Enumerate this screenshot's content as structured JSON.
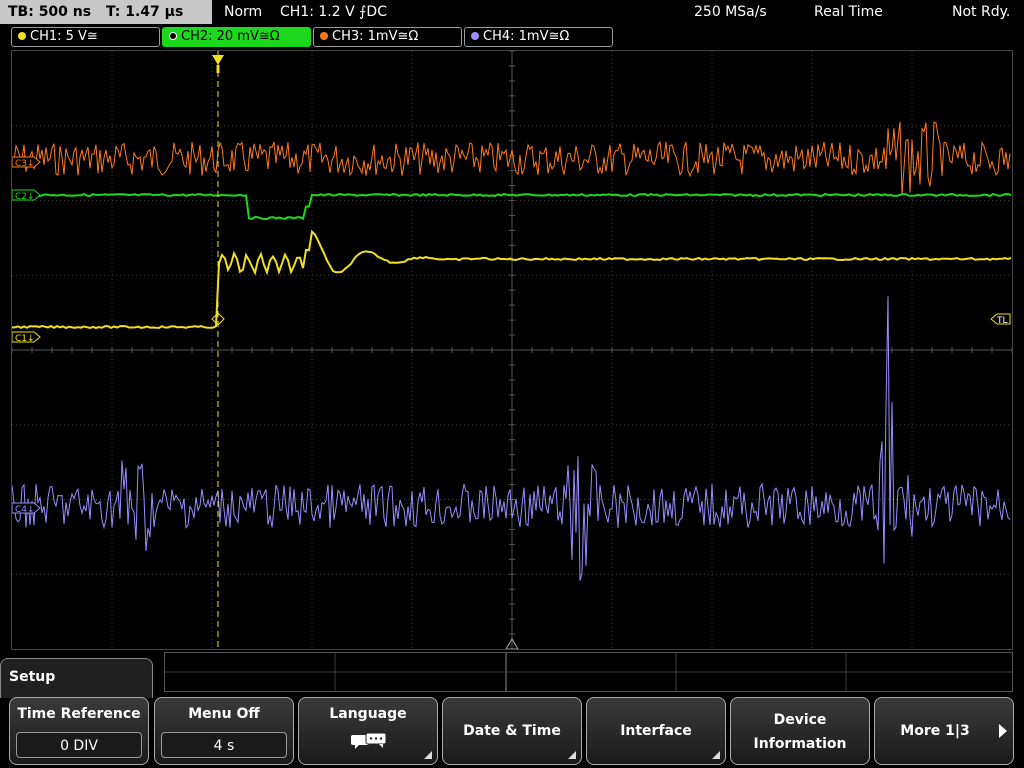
{
  "status": {
    "timebase": "TB: 500 ns",
    "trigger_time": "T: 1.47 µs",
    "mode": "Norm",
    "trigger_info": "CH1: 1.2 V ⨍DC",
    "sample_rate": "250 MSa/s",
    "acq_mode": "Real Time",
    "ready_state": "Not Rdy."
  },
  "channels": [
    {
      "label": "CH1: 5 V≅",
      "color": "#f0e020"
    },
    {
      "label": "CH2: 20 mV≅Ω",
      "color": "#1ed81e",
      "active": true
    },
    {
      "label": "CH3: 1mV≅Ω",
      "color": "#ff7a1a"
    },
    {
      "label": "CH4: 1mV≅Ω",
      "color": "#9a8cff"
    }
  ],
  "markers": {
    "trigger_level": "TL",
    "ch1": "C1↓",
    "ch2": "C2↓",
    "ch3": "C3↓",
    "ch4": "C4↓"
  },
  "menu": {
    "title": "Setup",
    "softkeys": [
      {
        "label": "Time Reference",
        "value": "0 DIV"
      },
      {
        "label": "Menu Off",
        "value": "4 s"
      },
      {
        "label": "Language",
        "icon": "speech-bubbles-icon"
      },
      {
        "label": "Date & Time"
      },
      {
        "label": "Interface"
      },
      {
        "label_line1": "Device",
        "label_line2": "Information"
      },
      {
        "label": "More 1|3"
      }
    ]
  },
  "colors": {
    "ch1": "#f0e020",
    "ch2": "#1ed81e",
    "ch3": "#ff7a1a",
    "ch4": "#9a8cff",
    "grid": "#3c3c3c"
  }
}
